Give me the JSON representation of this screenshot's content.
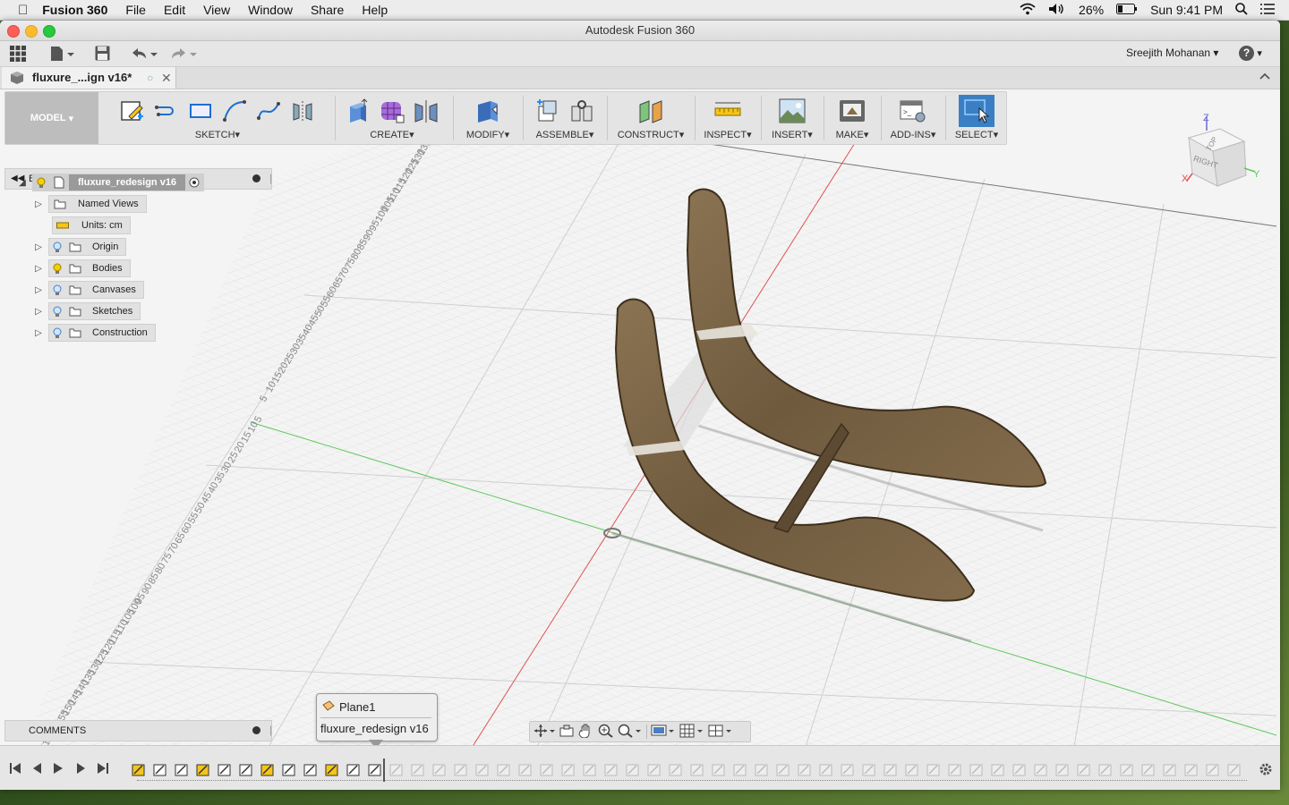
{
  "menubar": {
    "app_name": "Fusion 360",
    "items": [
      "File",
      "Edit",
      "View",
      "Window",
      "Share",
      "Help"
    ],
    "battery": "26%",
    "clock": "Sun 9:41 PM"
  },
  "window": {
    "title": "Autodesk Fusion 360",
    "user": "Sreejith Mohanan",
    "help_label": "?"
  },
  "document_tab": {
    "title": "fluxure_...ign v16*"
  },
  "toolbar": {
    "mode": "MODEL",
    "groups": [
      {
        "label": "SKETCH"
      },
      {
        "label": "CREATE"
      },
      {
        "label": "MODIFY"
      },
      {
        "label": "ASSEMBLE"
      },
      {
        "label": "CONSTRUCT"
      },
      {
        "label": "INSPECT"
      },
      {
        "label": "INSERT"
      },
      {
        "label": "MAKE"
      },
      {
        "label": "ADD-INS"
      },
      {
        "label": "SELECT"
      }
    ]
  },
  "browser": {
    "title": "BROWSER",
    "root": "fluxure_redesign v16",
    "items": [
      {
        "label": "Named Views"
      },
      {
        "label": "Units: cm"
      },
      {
        "label": "Origin"
      },
      {
        "label": "Bodies"
      },
      {
        "label": "Canvases"
      },
      {
        "label": "Sketches"
      },
      {
        "label": "Construction"
      }
    ]
  },
  "comments": {
    "title": "COMMENTS"
  },
  "tooltip": {
    "feature": "Plane1",
    "document": "fluxure_redesign v16"
  },
  "viewcube": {
    "top": "TOP",
    "right": "RIGHT",
    "axis_z": "Z",
    "axis_y": "Y",
    "axis_x": "X"
  },
  "ruler": {
    "near_labels": [
      "5",
      "10",
      "15",
      "20",
      "25",
      "30",
      "35",
      "40",
      "45",
      "50",
      "55",
      "60",
      "65",
      "70",
      "75",
      "80",
      "85",
      "90",
      "95",
      "100",
      "105",
      "110",
      "115",
      "120",
      "125",
      "130",
      "135",
      "140",
      "145",
      "150",
      "155",
      "160",
      "165"
    ],
    "far_labels": [
      "5",
      "10",
      "15",
      "20",
      "25",
      "30",
      "35",
      "40",
      "45",
      "50",
      "55",
      "60",
      "65",
      "70",
      "75",
      "80",
      "85",
      "90",
      "95",
      "100",
      "105",
      "110",
      "115",
      "120",
      "125",
      "130",
      "135",
      "140"
    ]
  },
  "colors": {
    "wood": "#7a6446",
    "wood_dark": "#3e2f1c",
    "select_blue": "#3a7fc4",
    "axis_red": "#e15050",
    "axis_green": "#5cc85c"
  }
}
